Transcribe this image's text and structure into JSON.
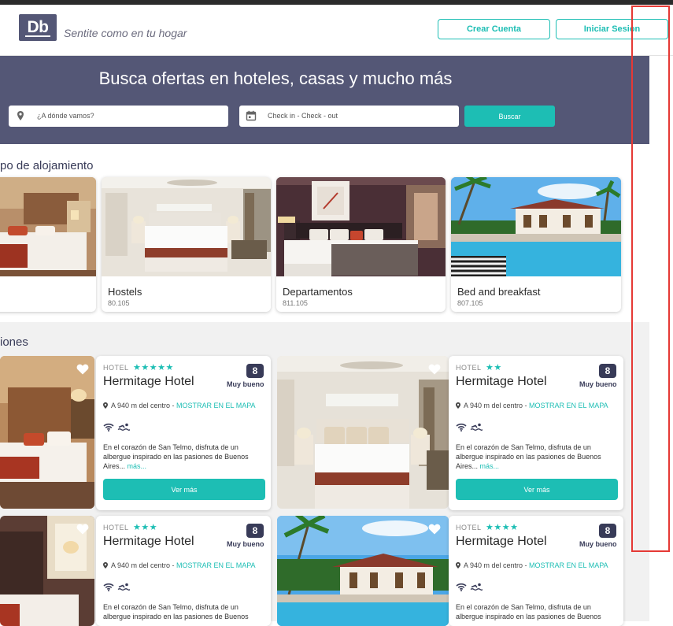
{
  "header": {
    "logo_text": "Db",
    "tagline": "Sentite como en tu hogar",
    "create_account_label": "Crear Cuenta",
    "login_label": "Iniciar Sesion"
  },
  "hero": {
    "title": "Busca ofertas en hoteles, casas y mucho más",
    "destination_placeholder": "¿A dónde vamos?",
    "dates_placeholder": "Check in - Check - out",
    "search_label": "Buscar"
  },
  "categories": {
    "title": "po de alojamiento",
    "items": [
      {
        "name": "",
        "count": ""
      },
      {
        "name": "Hostels",
        "count": "80.105"
      },
      {
        "name": "Departamentos",
        "count": "811.105"
      },
      {
        "name": "Bed and breakfast",
        "count": "807.105"
      }
    ]
  },
  "recommendations": {
    "title": "iones",
    "cards": [
      {
        "category": "HOTEL",
        "stars": "★★★★★",
        "name": "Hermitage Hotel",
        "score": "8",
        "rating": "Muy bueno",
        "distance": "A 940 m del centro - ",
        "map_link": "MOSTRAR EN EL MAPA",
        "description": "En el corazón de San Telmo, disfruta de un albergue inspirado en las pasiones de Buenos Aires... ",
        "more": "más...",
        "button": "Ver más"
      },
      {
        "category": "HOTEL",
        "stars": "★★",
        "name": "Hermitage Hotel",
        "score": "8",
        "rating": "Muy bueno",
        "distance": "A 940 m del centro - ",
        "map_link": "MOSTRAR EN EL MAPA",
        "description": "En el corazón de San Telmo, disfruta de un albergue inspirado en las pasiones de Buenos Aires... ",
        "more": "más...",
        "button": "Ver más"
      },
      {
        "category": "HOTEL",
        "stars": "★★★",
        "name": "Hermitage Hotel",
        "score": "8",
        "rating": "Muy bueno",
        "distance": "A 940 m del centro - ",
        "map_link": "MOSTRAR EN EL MAPA",
        "description": "En el corazón de San Telmo, disfruta de un albergue inspirado en las pasiones de Buenos",
        "more": "",
        "button": ""
      },
      {
        "category": "HOTEL",
        "stars": "★★★★",
        "name": "Hermitage Hotel",
        "score": "8",
        "rating": "Muy bueno",
        "distance": "A 940 m del centro - ",
        "map_link": "MOSTRAR EN EL MAPA",
        "description": "En el corazón de San Telmo, disfruta de un albergue inspirado en las pasiones de Buenos",
        "more": "",
        "button": ""
      }
    ]
  },
  "colors": {
    "brand_dark": "#545776",
    "accent": "#1dbeb4",
    "highlight_box": "#e53935"
  }
}
